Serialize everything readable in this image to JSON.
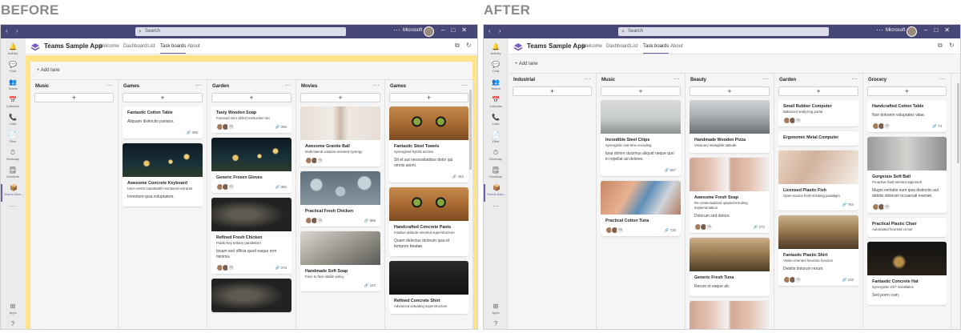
{
  "labels": {
    "before": "BEFORE",
    "after": "AFTER"
  },
  "app": {
    "search_placeholder": "Search",
    "org": "Microsoft",
    "app_name": "Teams Sample App",
    "tabs": [
      "Welcome",
      "Dashboard",
      "List",
      "Task boards",
      "About"
    ],
    "active_tab": "Task boards",
    "add_lane": "Add lane",
    "rail": [
      "Activity",
      "Chat",
      "Teams",
      "Calendar",
      "Calls",
      "Files",
      "Workday",
      "OneNote",
      "Teams Sam...",
      "Apps",
      "Help"
    ]
  },
  "colors": {
    "titlebar": "#464775",
    "accent": "#6264a7",
    "highlight_before": "#ffe48a"
  },
  "before_board": {
    "lanes": [
      {
        "title": "Music",
        "cards": []
      },
      {
        "title": "Games",
        "cards": [
          {
            "title": "Fantastic Cotton Table",
            "desc": "Aliquam distinctio pariatur.",
            "count": "398"
          },
          {
            "image": "img-lanterns",
            "title": "Awesome Concrete Keyboard",
            "sub": "User-centric bandwidth-monitored extranet",
            "desc": "Inventore ipsa voluptatem."
          }
        ]
      },
      {
        "title": "Garden",
        "cards": [
          {
            "title": "Tasty Wooden Soap",
            "sub": "Focused zero defect instruction set",
            "more": "+3",
            "count": "396"
          },
          {
            "image": "img-lanterns",
            "title": "Generic Frozen Gloves",
            "more": "+3",
            "count": "382"
          },
          {
            "image": "img-tunnel",
            "title": "Refined Fresh Chicken",
            "sub": "Public-key tertiary parallelism",
            "desc": "Ipsam sed officia quod eaque rem minima.",
            "more": "+3",
            "count": "376"
          },
          {
            "image": "img-tunnel",
            "title": ""
          }
        ]
      },
      {
        "title": "Movies",
        "cards": [
          {
            "image": "img-legs",
            "title": "Awesome Granite Ball",
            "sub": "Multi-lateral solution-oriented synergy",
            "more": "+3"
          },
          {
            "image": "img-drops",
            "title": "Practical Fresh Chicken",
            "more": "+3",
            "count": "998"
          },
          {
            "image": "img-dog",
            "title": "Handmade Soft Soap",
            "sub": "Face to face stable policy",
            "count": "153"
          }
        ]
      },
      {
        "title": "Games",
        "cards": [
          {
            "image": "img-cat",
            "title": "Fantastic Steel Towels",
            "sub": "Synergized hybrid archive",
            "desc": "Sit et aut necessitatibus dolor qui omnis animi.",
            "count": "462"
          },
          {
            "image": "img-cat",
            "title": "Handcrafted Concrete Pants",
            "sub": "Intuitive attitude-oriented superstructure",
            "desc": "Quam delectus dolorum ipsa et tempore beatae."
          },
          {
            "image": "img-darkgrey",
            "title": "Refined Concrete Shirt",
            "sub": "Advanced actuating superstructure"
          }
        ]
      }
    ]
  },
  "after_board": {
    "lanes": [
      {
        "title": "Industrial",
        "cards": []
      },
      {
        "title": "Music",
        "cards": [
          {
            "image": "img-street",
            "title": "Incredible Steel Chips",
            "sub": "Synergistic real-time encoding",
            "desc": "Ipsa dolore ducimus aliquid neque quo in repellat ad dolores.",
            "count": "667"
          },
          {
            "image": "img-phone",
            "title": "Practical Cotton Tuna",
            "more": "+3",
            "count": "728"
          }
        ]
      },
      {
        "title": "Beauty",
        "cards": [
          {
            "image": "img-city",
            "title": "Handmade Wooden Pizza",
            "sub": "Visionary intangible attitude"
          },
          {
            "image": "img-faces",
            "title": "Awesome Fresh Soap",
            "sub": "Re-contextualized upward-trending implementation",
            "desc": "Dolorum sed dolore.",
            "more": "+3",
            "count": "370"
          },
          {
            "image": "img-hills",
            "title": "Generic Fresh Tuna",
            "desc": "Rerum et eaque ab."
          },
          {
            "image": "img-faces",
            "title": ""
          }
        ]
      },
      {
        "title": "Garden",
        "cards": [
          {
            "title": "Small Rubber Computer",
            "sub": "Balanced analyzing portal",
            "more": "+3"
          },
          {
            "title": "Ergonomic Metal Computer"
          },
          {
            "image": "img-face",
            "title": "Licensed Plastic Fish",
            "sub": "Open-source fresh-thinking paradigm",
            "count": "784"
          },
          {
            "image": "img-hills",
            "title": "Fantastic Plastic Shirt",
            "sub": "Vision-oriented heuristic function",
            "desc": "Debitis dolorum rerum.",
            "more": "+3",
            "count": "332"
          }
        ]
      },
      {
        "title": "Grocery",
        "cards": [
          {
            "title": "Handcrafted Cotton Table",
            "desc": "Non dolorem voluptates vitae.",
            "more": "+3",
            "count": "74"
          },
          {
            "image": "img-wall",
            "title": "Gorgeous Soft Ball",
            "sub": "Proactive fault-tolerant approach",
            "desc": "Magni veritatis eum ipsa distinctio aut debitis dolorum occaecati eveniet.",
            "more": "+3"
          },
          {
            "title": "Practical Plastic Chair",
            "sub": "Automated heuristic circuit"
          },
          {
            "image": "img-lights",
            "title": "Fantastic Concrete Hat",
            "sub": "Synergistic 24/7 installation",
            "desc": "Sed porro cum."
          }
        ]
      }
    ]
  }
}
